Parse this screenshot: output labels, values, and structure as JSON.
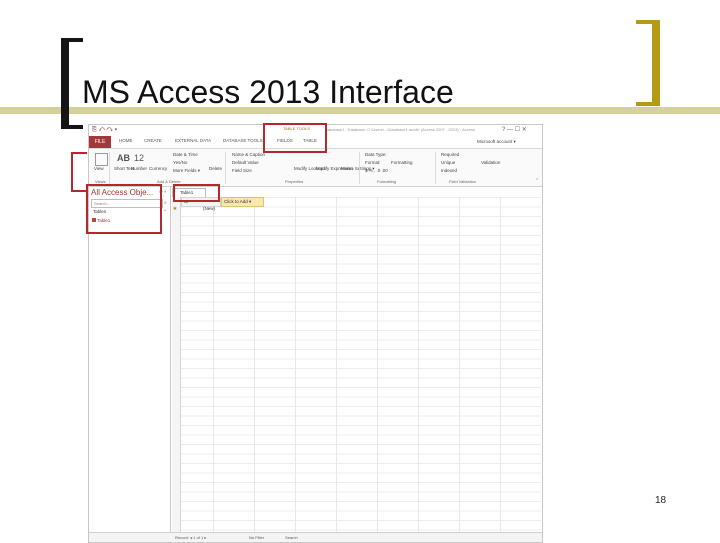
{
  "slide": {
    "title": "MS Access 2013 Interface",
    "page_number": "18"
  },
  "colors": {
    "accent_gold": "#b59a18",
    "highlight_red": "#b4282d",
    "access_red": "#a4373a",
    "rule_line": "#d4d19a"
  },
  "window": {
    "quick_access": "⎘ ↶ ↷ ▾",
    "contextual_label": "TABLE TOOLS",
    "title": "Database1 : Database- C:\\Users\\...\\Database1.accdb (Access 2007 - 2013) - Access",
    "controls": "? — ☐ ✕",
    "account": "Microsoft account ▾"
  },
  "ribbon": {
    "tabs": [
      "FILE",
      "HOME",
      "CREATE",
      "EXTERNAL DATA",
      "DATABASE TOOLS",
      "FIELDS",
      "TABLE"
    ],
    "view_label": "View",
    "short_text": "Short Text",
    "number": "Number",
    "currency": "Currency",
    "date_time": "Date & Time",
    "yes_no": "Yes/No",
    "more_fields": "More Fields ▾",
    "delete_label": "Delete",
    "name_caption": "Name & Caption",
    "default_value": "Default Value",
    "field_size": "Field Size",
    "modify_lookups": "Modify Lookups",
    "modify_expression": "Modify Expression",
    "memo_settings": "Memo Settings ▾",
    "data_type": "Data Type:",
    "format": "Format:",
    "formatting": "Formatting",
    "required": "Required",
    "unique": "Unique",
    "indexed": "Indexed",
    "validation": "Validation",
    "groups": {
      "views": "Views",
      "add_delete": "Add & Delete",
      "properties": "Properties",
      "formatting": "Formatting",
      "field_validation": "Field Validation"
    }
  },
  "nav": {
    "header": "All Access Obje...",
    "search_placeholder": "Search...",
    "section": "Tables",
    "items": [
      "Table1"
    ]
  },
  "datasheet": {
    "tab_label": "Table1",
    "id_header": "ID",
    "add_header": "Click to Add ▾",
    "new_row": "(New)"
  },
  "statusbar": {
    "record": "Record: ◂ 1 of 1 ▸",
    "filter": "No Filter",
    "search": "Search"
  }
}
